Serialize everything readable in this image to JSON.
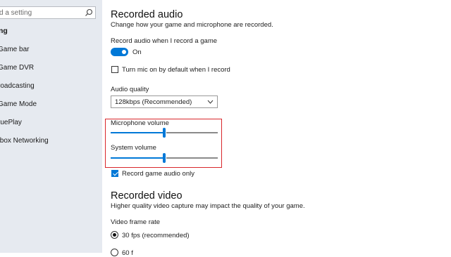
{
  "sidebar": {
    "search_placeholder": "d a setting",
    "section": "ng",
    "items": [
      {
        "label": "Game bar"
      },
      {
        "label": "Game DVR"
      },
      {
        "label": "roadcasting"
      },
      {
        "label": "Game Mode"
      },
      {
        "label": "ruePlay"
      },
      {
        "label": "tbox Networking"
      }
    ]
  },
  "recorded_audio": {
    "title": "Recorded audio",
    "description": "Change how your game and microphone are recorded.",
    "record_label": "Record audio when I record a game",
    "toggle_state": "On",
    "mic_checkbox_label": "Turn mic on by default when I record",
    "mic_checkbox_checked": false,
    "quality_label": "Audio quality",
    "quality_value": "128kbps (Recommended)",
    "microphone_volume_label": "Microphone volume",
    "microphone_volume_percent": 50,
    "system_volume_label": "System volume",
    "system_volume_percent": 50,
    "game_audio_only_label": "Record game audio only",
    "game_audio_only_checked": true
  },
  "recorded_video": {
    "title": "Recorded video",
    "description": "Higher quality video capture may impact the quality of your game.",
    "frame_rate_label": "Video frame rate",
    "frame_rate_option_1": "30 fps (recommended)",
    "frame_rate_option_2": "60 f"
  }
}
